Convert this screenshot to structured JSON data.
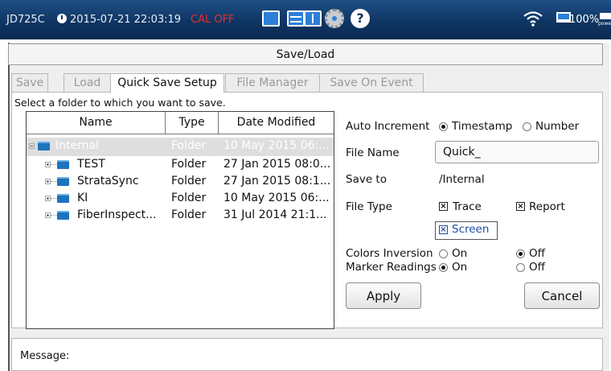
{
  "status": {
    "model": "JD725C",
    "datetime": "2015-07-21 22:03:19",
    "cal": "CAL OFF",
    "battery": "100%",
    "power_label": "power"
  },
  "window": {
    "title": "Save/Load"
  },
  "tabs": [
    {
      "label": "Save"
    },
    {
      "label": "Load"
    },
    {
      "label": "Quick Save Setup"
    },
    {
      "label": "File Manager"
    },
    {
      "label": "Save On Event"
    }
  ],
  "instruction": "Select a folder to which you want to save.",
  "table": {
    "columns": [
      "Name",
      "Type",
      "Date Modified"
    ],
    "rows": [
      {
        "name": "Internal",
        "type": "Folder",
        "date": "10 May 2015 06:..."
      },
      {
        "name": "TEST",
        "type": "Folder",
        "date": "27 Jan 2015 08:0..."
      },
      {
        "name": "StrataSync",
        "type": "Folder",
        "date": "27 Jan 2015 08:1..."
      },
      {
        "name": "KI",
        "type": "Folder",
        "date": "10 May 2015 06:..."
      },
      {
        "name": "FiberInspect...",
        "type": "Folder",
        "date": "31 Jul 2014 21:1..."
      }
    ]
  },
  "form": {
    "auto_increment_label": "Auto Increment",
    "timestamp_label": "Timestamp",
    "number_label": "Number",
    "file_name_label": "File Name",
    "file_name_value": "Quick_",
    "save_to_label": "Save to",
    "save_to_value": "/Internal",
    "file_type_label": "File Type",
    "trace_label": "Trace",
    "report_label": "Report",
    "screen_label": "Screen",
    "colors_inversion_label": "Colors Inversion",
    "marker_readings_label": "Marker Readings",
    "on_label": "On",
    "off_label": "Off",
    "apply_label": "Apply",
    "cancel_label": "Cancel"
  },
  "message_label": "Message:",
  "colors": {
    "statusbar": "#0f3563",
    "accent": "#1e73be",
    "cal_off": "#e1322c"
  }
}
